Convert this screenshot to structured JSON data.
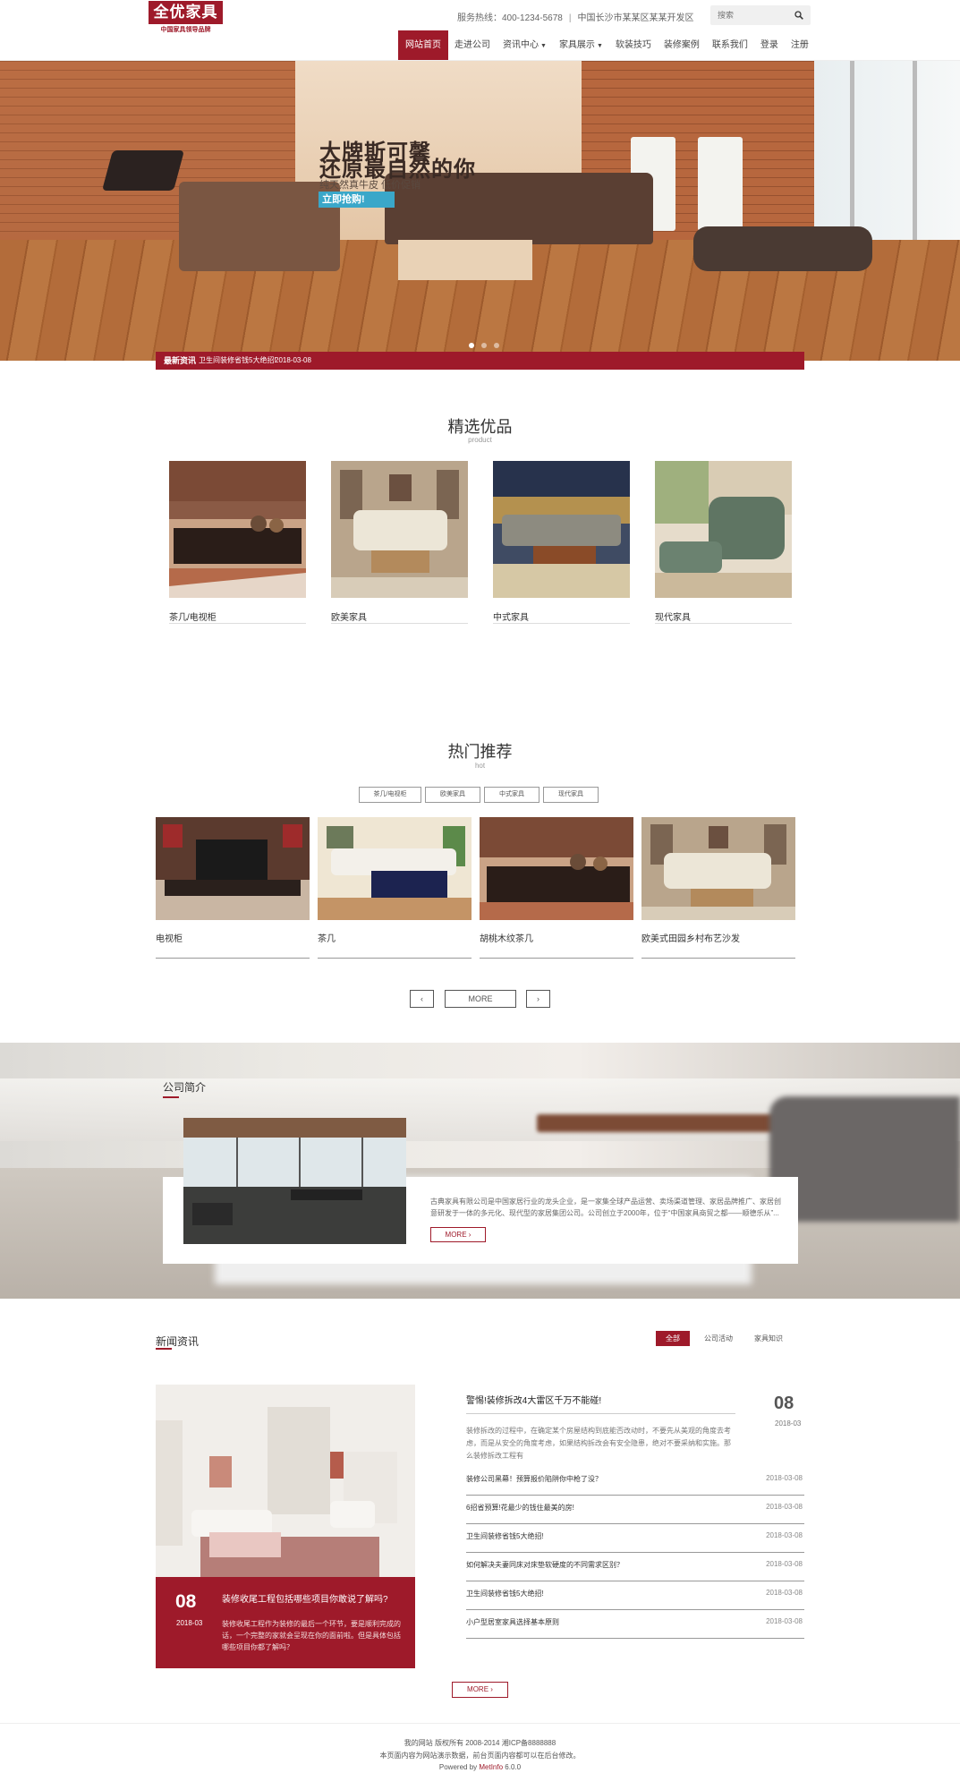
{
  "header": {
    "logo_text": "全优家具",
    "logo_sub": "中国家具领导品牌",
    "hotline": "服务热线：400-1234-5678",
    "separator": "|",
    "address": "中国长沙市某某区某某开发区",
    "search_placeholder": "搜索",
    "nav": [
      {
        "label": "网站首页",
        "active": true
      },
      {
        "label": "走进公司"
      },
      {
        "label": "资讯中心",
        "dropdown": true
      },
      {
        "label": "家具展示",
        "dropdown": true
      },
      {
        "label": "软装技巧"
      },
      {
        "label": "装修案例"
      },
      {
        "label": "联系我们"
      },
      {
        "label": "登录"
      },
      {
        "label": "注册"
      }
    ]
  },
  "banner": {
    "headline_1": "大牌斯可馨",
    "headline_2": "还原最自然的你",
    "subline": "纯天然真牛皮 低价促销",
    "cta": "立即抢购!",
    "slides_total": 3,
    "slide_active": 1
  },
  "ticker": {
    "label": "最新资讯",
    "text": "卫生间装修省钱5大绝招!",
    "date": "2018-03-08"
  },
  "products": {
    "title": "精选优品",
    "subtitle": "product",
    "items": [
      {
        "name": "茶几/电视柜"
      },
      {
        "name": "欧美家具"
      },
      {
        "name": "中式家具"
      },
      {
        "name": "现代家具"
      }
    ]
  },
  "hot": {
    "title": "热门推荐",
    "subtitle": "hot",
    "tabs": [
      "茶几/电视柜",
      "欧美家具",
      "中式家具",
      "现代家具"
    ],
    "items": [
      {
        "name": "电视柜"
      },
      {
        "name": "茶几"
      },
      {
        "name": "胡桃木纹茶几"
      },
      {
        "name": "欧美式田园乡村布艺沙发"
      }
    ],
    "prev": "‹",
    "more": "MORE",
    "next": "›"
  },
  "about": {
    "title": "公司简介",
    "text": "古典家具有限公司是中国家居行业的龙头企业，是一家集全球产品运营、卖场渠道管理、家居品牌推广、家居创意研发于一体的多元化、现代型的家居集团公司。公司创立于2000年，位于“中国家具商贸之都——顺德乐从”...",
    "more": "MORE",
    "more_arrow": "›"
  },
  "news": {
    "title": "新闻资讯",
    "tabs": [
      {
        "label": "全部",
        "active": true
      },
      {
        "label": "公司活动"
      },
      {
        "label": "家具知识"
      }
    ],
    "featured": {
      "day": "08",
      "year_month": "2018-03",
      "title": "装修收尾工程包括哪些项目你敢说了解吗?",
      "desc": "装修收尾工程作为装修的最后一个环节，要是顺利完成的话，一个完整的家就会呈现在你的面前啦。但是具体包括哪些项目你都了解吗？"
    },
    "top": {
      "title": "警惕!装修拆改4大雷区千万不能碰!",
      "desc": "装修拆改的过程中，在确定某个房屋结构到底能否改动时，不要先从美观的角度去考虑，而是从安全的角度考虑，如果结构拆改会有安全隐患，绝对不要采纳和实施。那么装修拆改工程有",
      "day": "08",
      "year_month": "2018-03"
    },
    "list": [
      {
        "title": "装修公司黑幕！预算报价陷阱你中枪了没？",
        "date": "2018-03-08"
      },
      {
        "title": "6招省预算!花最少的钱住最美的房!",
        "date": "2018-03-08"
      },
      {
        "title": "卫生间装修省钱5大绝招!",
        "date": "2018-03-08"
      },
      {
        "title": "如何解决夫妻同床对床垫软硬度的不同需求区别？",
        "date": "2018-03-08"
      },
      {
        "title": "卫生间装修省钱5大绝招!",
        "date": "2018-03-08"
      },
      {
        "title": "小户型居室家具选择基本原则",
        "date": "2018-03-08"
      }
    ],
    "more": "MORE",
    "more_arrow": "›"
  },
  "footer": {
    "line1": "我的网站 版权所有 2008-2014 湘ICP备8888888",
    "line2": "本页面内容为网站演示数据，前台页面内容都可以在后台修改。",
    "powered_prefix": "Powered by",
    "powered_brand": "MetInfo",
    "powered_version": "6.0.0"
  },
  "colors": {
    "brand": "#9e1a2a",
    "banner_cta": "#3aa7c9"
  }
}
